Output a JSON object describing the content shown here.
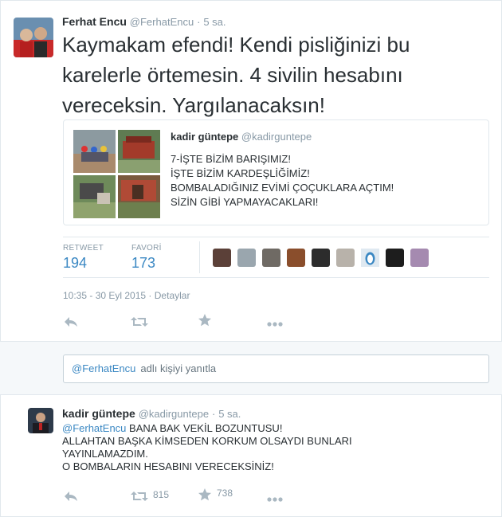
{
  "main_tweet": {
    "author_name": "Ferhat Encu",
    "author_handle": "@FerhatEncu",
    "time": "5 sa.",
    "text": [
      "Kaymakam efendi! Kendi pisliğinizi bu",
      "karelerle örtemesin. 4 sivilin hesabını",
      "vereceksin. Yargılanacaksın!"
    ],
    "quote": {
      "author_name": "kadir güntepe",
      "author_handle": "@kadirguntepe",
      "lines": [
        "7-İŞTE BİZİM BARIŞIMIZ!",
        "İŞTE BİZİM KARDEŞLİĞİMİZ!",
        "BOMBALADIĞINIZ EVİMİ ÇOÇUKLARA AÇTIM!",
        "SİZİN GİBİ YAPMAYACAKLARI!"
      ]
    },
    "stats": {
      "retweet_label": "RETWEET",
      "retweet_count": "194",
      "favorite_label": "FAVORİ",
      "favorite_count": "173"
    },
    "timestamp": "10:35 - 30 Eyl 2015",
    "details_link": "Detaylar"
  },
  "reply_box": {
    "mention": "@FerhatEncu",
    "placeholder": "adlı kişiyi yanıtla"
  },
  "reply_tweet": {
    "author_name": "kadir güntepe",
    "author_handle": "@kadirguntepe",
    "time": "5 sa.",
    "mention": "@FerhatEncu",
    "first_line_rest": "BANA BAK VEKİL BOZUNTUSU!",
    "lines": [
      "ALLAHTAN BAŞKA KİMSEDEN KORKUM OLSAYDI BUNLARI",
      "YAYINLAMAZDIM.",
      "O BOMBALARIN HESABINI VERECEKSİNİZ!"
    ],
    "retweet_count": "815",
    "favorite_count": "738"
  },
  "colors": {
    "link": "#3b88c3",
    "muted": "#8899a6",
    "text": "#292f33",
    "border": "#e1e8ed",
    "action_icon": "#aab8c2"
  },
  "icons": [
    "reply-icon",
    "retweet-icon",
    "favorite-star-icon",
    "more-icon"
  ]
}
